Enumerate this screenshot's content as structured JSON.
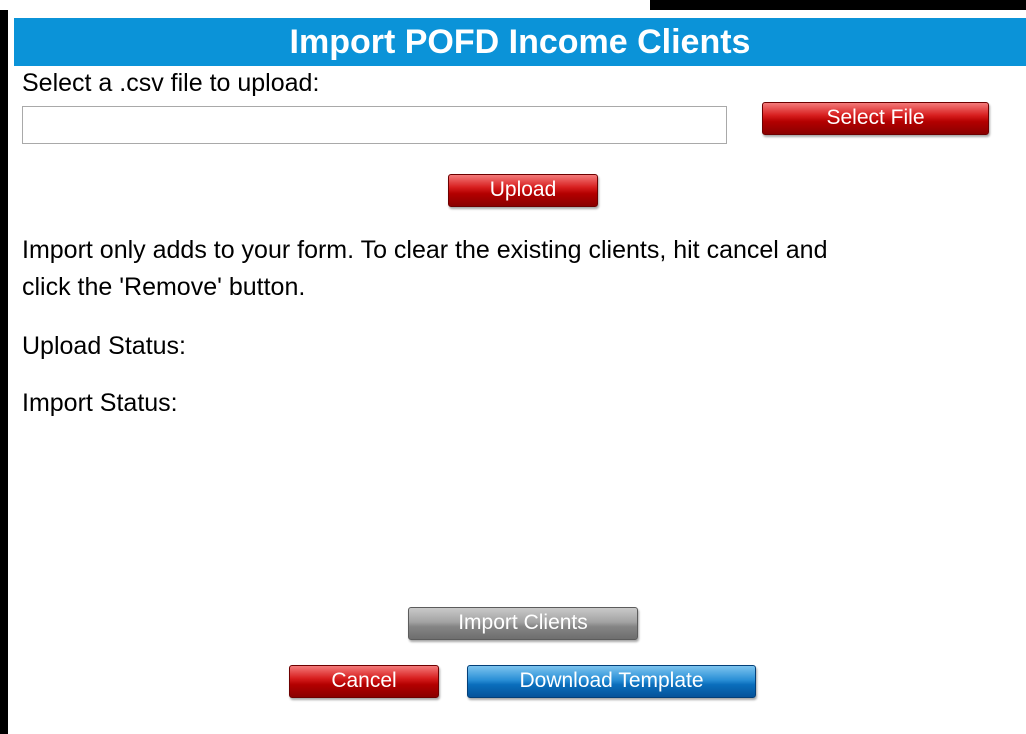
{
  "dialog": {
    "title": "Import POFD Income Clients",
    "select_prompt": "Select a .csv file to upload:",
    "file_input": {
      "value": "",
      "placeholder": ""
    },
    "select_file_label": "Select File",
    "upload_label": "Upload",
    "info_line1": "Import only adds to your form. To clear the existing clients, hit cancel and",
    "info_line2": "click the 'Remove' button.",
    "upload_status_label": "Upload Status:",
    "import_status_label": "Import Status:",
    "import_clients_label": "Import Clients",
    "cancel_label": "Cancel",
    "download_template_label": "Download Template"
  },
  "colors": {
    "title_bar": "#0b93d8",
    "primary_button": "#c00000",
    "disabled_button": "#8e8e8e",
    "secondary_button": "#0a6ebc"
  }
}
